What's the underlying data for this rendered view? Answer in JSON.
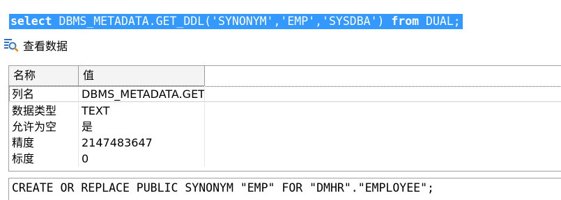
{
  "sql": {
    "kw_select": "select",
    "middle": " DBMS_METADATA.GET_DDL('SYNONYM','EMP','SYSDBA') ",
    "kw_from": "from",
    "tail": " DUAL;"
  },
  "panel": {
    "title": "查看数据",
    "icon": "view-data-icon"
  },
  "grid": {
    "headers": [
      "名称",
      "值"
    ],
    "rows": [
      {
        "name": "列名",
        "value": "DBMS_METADATA.GET_DDL('SYNONYM','EMP','SYSDBA')"
      },
      {
        "name": "数据类型",
        "value": "TEXT"
      },
      {
        "name": "允许为空",
        "value": "是"
      },
      {
        "name": "精度",
        "value": "2147483647"
      },
      {
        "name": "标度",
        "value": "0"
      }
    ]
  },
  "result": {
    "text": "CREATE OR REPLACE PUBLIC SYNONYM \"EMP\" FOR \"DMHR\".\"EMPLOYEE\";"
  },
  "colors": {
    "selection": "#3399ff",
    "header_bg": "#f4f4f4",
    "border": "#a0a0a0"
  }
}
